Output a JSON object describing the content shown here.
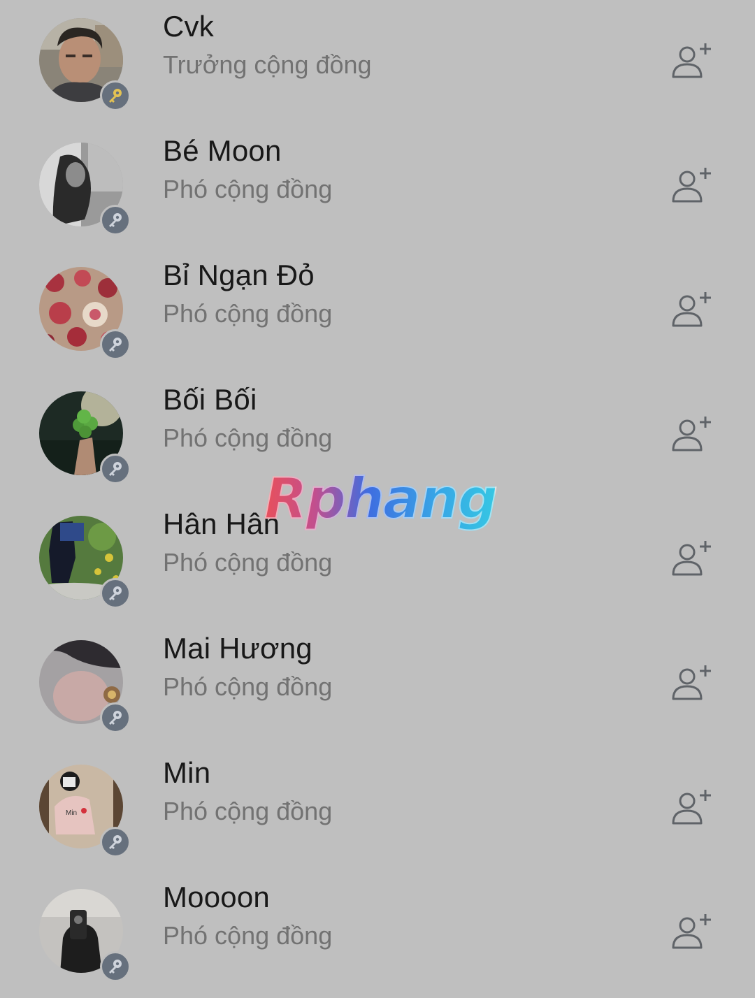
{
  "members": [
    {
      "name": "Cvk",
      "role": "Trưởng cộng đồng",
      "badge_color": "#e3c253",
      "avatar": "photo-man"
    },
    {
      "name": "Bé Moon",
      "role": "Phó cộng đồng",
      "badge_color": "#cfd4dc",
      "avatar": "photo-grayscale"
    },
    {
      "name": "Bỉ Ngạn Đỏ",
      "role": "Phó cộng đồng",
      "badge_color": "#cfd4dc",
      "avatar": "photo-flowers"
    },
    {
      "name": "Bối Bối",
      "role": "Phó cộng đồng",
      "badge_color": "#cfd4dc",
      "avatar": "photo-clover"
    },
    {
      "name": "Hân Hân",
      "role": "Phó cộng đồng",
      "badge_color": "#cfd4dc",
      "avatar": "photo-garden"
    },
    {
      "name": "Mai Hương",
      "role": "Phó cộng đồng",
      "badge_color": "#cfd4dc",
      "avatar": "photo-soft"
    },
    {
      "name": "Min",
      "role": "Phó cộng đồng",
      "badge_color": "#cfd4dc",
      "avatar": "photo-mirror",
      "avatar_text": "Min"
    },
    {
      "name": "Moooon",
      "role": "Phó cộng đồng",
      "badge_color": "#cfd4dc",
      "avatar": "photo-selfie"
    }
  ],
  "icons": {
    "add_friend": "add-friend-icon",
    "key": "key-icon"
  },
  "watermark": "Rphang"
}
